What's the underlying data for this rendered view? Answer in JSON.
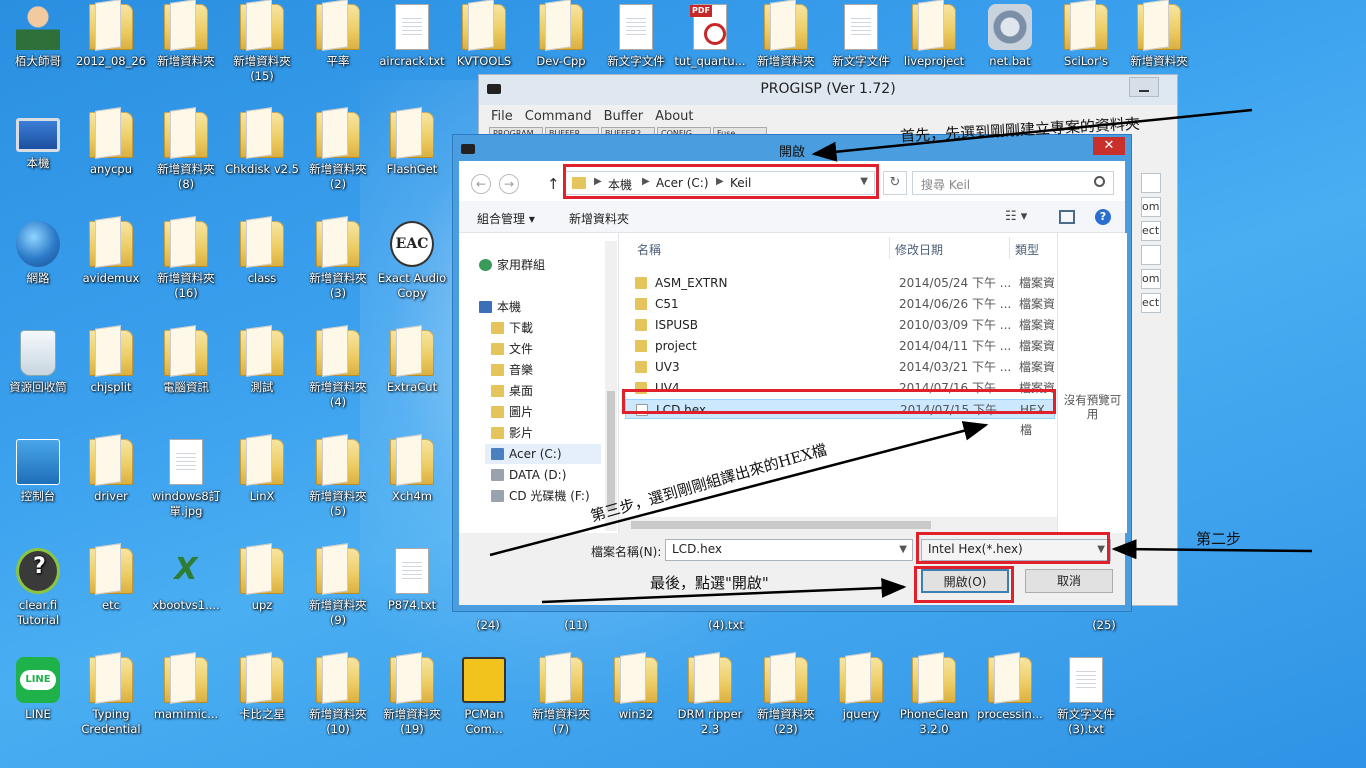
{
  "desktop": {
    "icons": [
      {
        "label": "栢大師哥",
        "type": "user"
      },
      {
        "label": "2012_08_26",
        "type": "folder"
      },
      {
        "label": "新增資料夾",
        "type": "folder"
      },
      {
        "label": "新增資料夾 (15)",
        "type": "folder"
      },
      {
        "label": "平率",
        "type": "folder"
      },
      {
        "label": "aircrack.txt",
        "type": "file"
      },
      {
        "label": "KVTOOLS",
        "type": "folder"
      },
      {
        "label": "Dev-Cpp",
        "type": "folder"
      },
      {
        "label": "新文字文件",
        "type": "file"
      },
      {
        "label": "tut_quartu...",
        "type": "pdf"
      },
      {
        "label": "新增資料夾",
        "type": "folder"
      },
      {
        "label": "新文字文件",
        "type": "file"
      },
      {
        "label": "liveproject",
        "type": "folder"
      },
      {
        "label": "net.bat",
        "type": "gear"
      },
      {
        "label": "SciLor's",
        "type": "folder"
      },
      {
        "label": "新增資料夾",
        "type": "folder"
      },
      {
        "label": "本機",
        "type": "monitor"
      },
      {
        "label": "anycpu",
        "type": "folder"
      },
      {
        "label": "新增資料夾 (8)",
        "type": "folder"
      },
      {
        "label": "Chkdisk v2.5",
        "type": "folder"
      },
      {
        "label": "新增資料夾 (2)",
        "type": "folder"
      },
      {
        "label": "FlashGet",
        "type": "folder"
      },
      {
        "label": "網路",
        "type": "globe"
      },
      {
        "label": "avidemux",
        "type": "folder"
      },
      {
        "label": "新增資料夾 (16)",
        "type": "folder"
      },
      {
        "label": "class",
        "type": "folder"
      },
      {
        "label": "新增資料夾 (3)",
        "type": "folder"
      },
      {
        "label": "Exact Audio Copy",
        "type": "eac"
      },
      {
        "label": "資源回收筒",
        "type": "recycle"
      },
      {
        "label": "chjsplit",
        "type": "folder"
      },
      {
        "label": "電腦資訊",
        "type": "folder"
      },
      {
        "label": "測試",
        "type": "folder"
      },
      {
        "label": "新增資料夾 (4)",
        "type": "folder"
      },
      {
        "label": "ExtraCut",
        "type": "folder"
      },
      {
        "label": "控制台",
        "type": "control"
      },
      {
        "label": "driver",
        "type": "folder"
      },
      {
        "label": "windows8訂單.jpg",
        "type": "file"
      },
      {
        "label": "LinX",
        "type": "folder"
      },
      {
        "label": "新增資料夾 (5)",
        "type": "folder"
      },
      {
        "label": "Xch4m",
        "type": "folder"
      },
      {
        "label": "clear.fi Tutorial",
        "type": "clearfi"
      },
      {
        "label": "etc",
        "type": "folder"
      },
      {
        "label": "xbootvs1....",
        "type": "xboot"
      },
      {
        "label": "upz",
        "type": "folder"
      },
      {
        "label": "新增資料夾 (9)",
        "type": "folder"
      },
      {
        "label": "P874.txt",
        "type": "file"
      },
      {
        "label": "LINE",
        "type": "line"
      },
      {
        "label": "Typing Credential",
        "type": "folder"
      },
      {
        "label": "mamimic...",
        "type": "folder"
      },
      {
        "label": "卡比之星",
        "type": "folder"
      },
      {
        "label": "新增資料夾 (10)",
        "type": "folder"
      },
      {
        "label": "新增資料夾 (19)",
        "type": "folder"
      },
      {
        "label": "PCMan Com...",
        "type": "pcman"
      },
      {
        "label": "新增資料夾 (7)",
        "type": "folder"
      },
      {
        "label": "win32",
        "type": "folder"
      },
      {
        "label": "DRM ripper 2.3",
        "type": "folder"
      },
      {
        "label": "新增資料夾 (23)",
        "type": "folder"
      },
      {
        "label": "jquery",
        "type": "folder"
      },
      {
        "label": "PhoneClean 3.2.0",
        "type": "folder"
      },
      {
        "label": "processin...",
        "type": "folder"
      },
      {
        "label": "新文字文件 (3).txt",
        "type": "file"
      }
    ],
    "partial_labels": {
      "r5_a": "(24)",
      "r5_b": "(11)",
      "r5_c": "(4).txt",
      "r5_d": "(25)"
    }
  },
  "progisp": {
    "title": "PROGISP (Ver 1.72)",
    "menu": [
      "File",
      "Command",
      "Buffer",
      "About"
    ],
    "tabs": [
      "PROGRAM",
      "BUFFER",
      "BUFFER2",
      "CONFIG",
      "Fuse"
    ],
    "side_fields": [
      "",
      "om",
      "ect",
      "",
      "om",
      "ect"
    ]
  },
  "dialog": {
    "title": "開啟",
    "close_glyph": "✕",
    "path": [
      "本機",
      "Acer (C:)",
      "Keil"
    ],
    "search_placeholder": "搜尋 Keil",
    "toolbar": {
      "organize": "組合管理 ▾",
      "new_folder": "新增資料夾",
      "view_glyph": "☷ ▾",
      "help_glyph": "?"
    },
    "nav": {
      "homegroup": "家用群組",
      "this_pc": "本機",
      "items": [
        "下載",
        "文件",
        "音樂",
        "桌面",
        "圖片",
        "影片",
        "Acer (C:)",
        "DATA (D:)",
        "CD 光碟機 (F:)"
      ]
    },
    "columns": {
      "name": "名稱",
      "date": "修改日期",
      "type": "類型"
    },
    "files": [
      {
        "name": "ASM_EXTRN",
        "date": "2014/05/24 下午 ...",
        "type": "檔案資",
        "kind": "folder"
      },
      {
        "name": "C51",
        "date": "2014/06/26 下午 ...",
        "type": "檔案資",
        "kind": "folder"
      },
      {
        "name": "ISPUSB",
        "date": "2010/03/09 下午 ...",
        "type": "檔案資",
        "kind": "folder"
      },
      {
        "name": "project",
        "date": "2014/04/11 下午 ...",
        "type": "檔案資",
        "kind": "folder"
      },
      {
        "name": "UV3",
        "date": "2014/03/21 下午 ...",
        "type": "檔案資",
        "kind": "folder"
      },
      {
        "name": "UV4",
        "date": "2014/07/16 下午 ...",
        "type": "檔案資",
        "kind": "folder"
      },
      {
        "name": "LCD.hex",
        "date": "2014/07/15 下午 ...",
        "type": "HEX 檔",
        "kind": "file",
        "selected": true
      }
    ],
    "preview_text": "沒有預覽可用",
    "filename_label": "檔案名稱(N):",
    "filename_value": "LCD.hex",
    "filetype_value": "Intel Hex(*.hex)",
    "open_label": "開啟(O)",
    "cancel_label": "取消"
  },
  "annotations": {
    "step1": "首先，先選到剛剛建立專案的資料夾",
    "step2": "第二步",
    "step3": "第三步，選到剛剛組譯出來的HEX檔",
    "step4": "最後，點選\"開啟\""
  },
  "colors": {
    "annotation_red": "#e0202a",
    "wallpaper_blue": "#2f93e6"
  }
}
